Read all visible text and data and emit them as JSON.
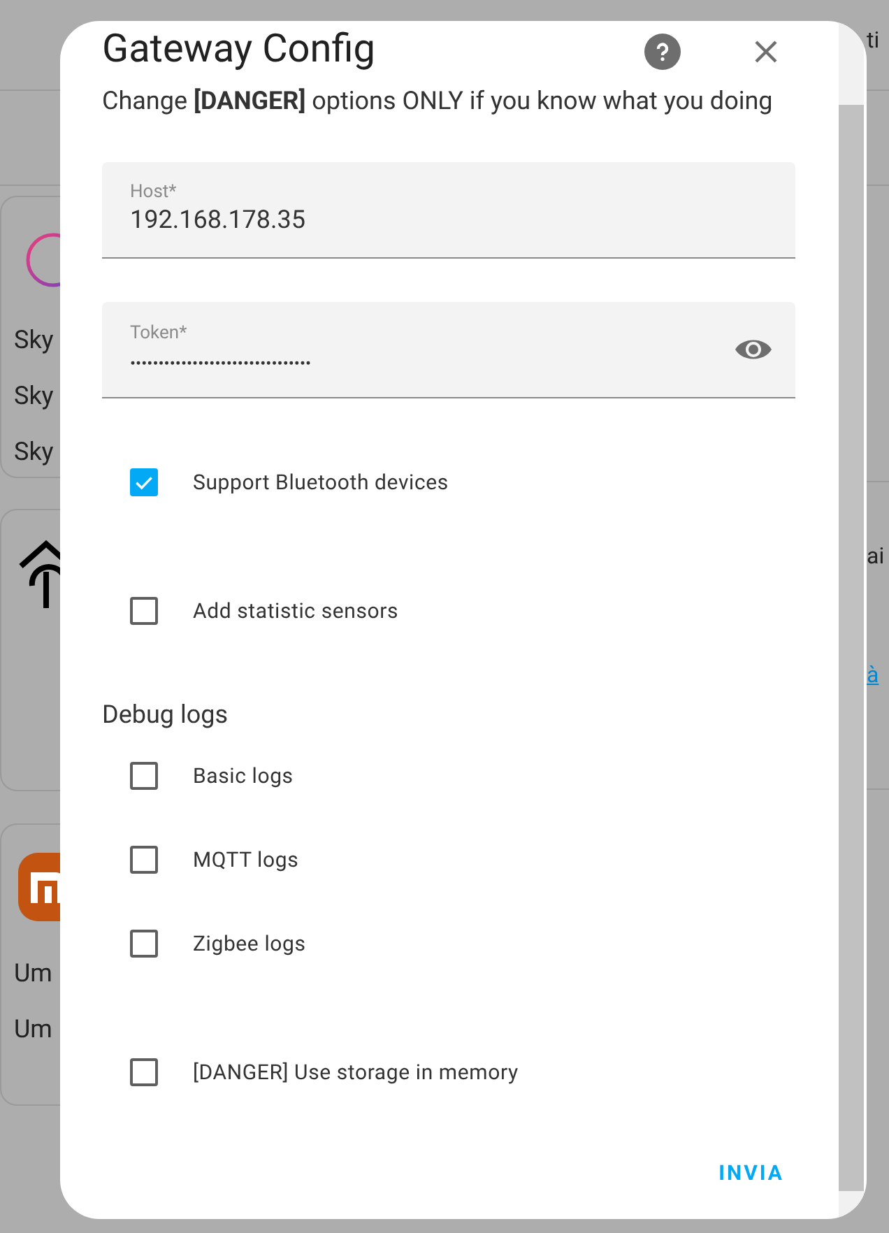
{
  "background": {
    "left_cards": [
      {
        "kind": "ring",
        "texts": [
          "Sky",
          "Sky",
          "Sky"
        ]
      },
      {
        "kind": "house"
      },
      {
        "kind": "brand",
        "texts": [
          "Um",
          "Um"
        ]
      }
    ],
    "right": {
      "header": "ti",
      "label": "ai",
      "link": "à"
    }
  },
  "dialog": {
    "title": "Gateway Config",
    "description": "Change **[DANGER]** options ONLY if you know what you doing",
    "fields": [
      {
        "kind": "text",
        "label": "Host*",
        "value": "192.168.178.35"
      },
      {
        "kind": "password",
        "label": "Token*",
        "value": "••••••••••••••••••••••••••••••••"
      }
    ],
    "groups": [
      {
        "items": [
          {
            "label": "Support Bluetooth devices",
            "checked": true
          }
        ]
      },
      {
        "items": [
          {
            "label": "Add statistic sensors",
            "checked": false
          }
        ]
      },
      {
        "heading": "Debug logs",
        "items": [
          {
            "label": "Basic logs",
            "checked": false
          },
          {
            "label": "MQTT logs",
            "checked": false
          },
          {
            "label": "Zigbee logs",
            "checked": false
          }
        ]
      },
      {
        "items": [
          {
            "label": "[DANGER] Use storage in memory",
            "checked": false
          }
        ]
      }
    ],
    "submit": "INVIA"
  }
}
